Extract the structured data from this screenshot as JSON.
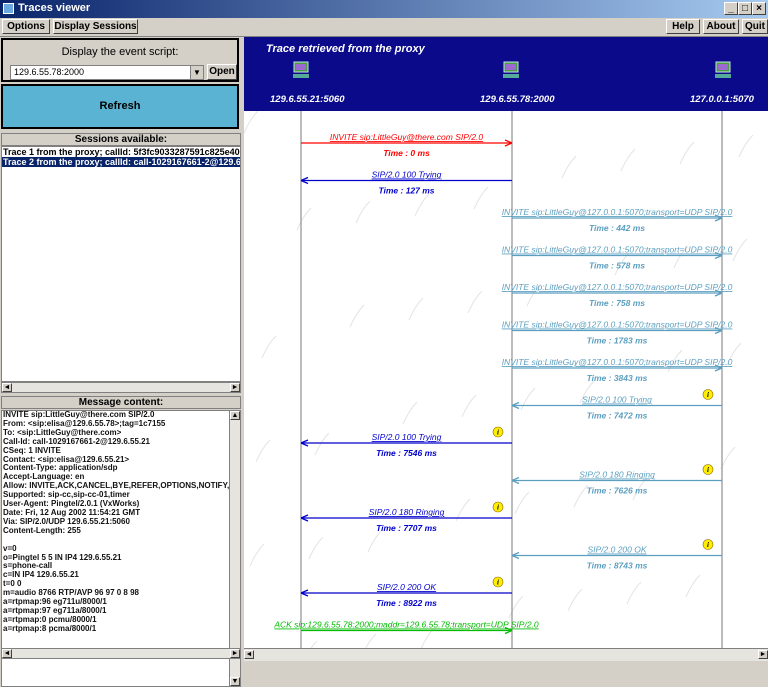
{
  "window": {
    "title": "Traces viewer",
    "controls": [
      "_",
      "□",
      "×"
    ]
  },
  "menubar": {
    "options": "Options",
    "display_sessions": "Display Sessions",
    "help": "Help",
    "about": "About",
    "quit": "Quit"
  },
  "script_panel": {
    "label": "Display the event script:",
    "selected": "129.6.55.78:2000",
    "open_label": "Open",
    "refresh_label": "Refresh"
  },
  "sessions": {
    "header": "Sessions available:",
    "items": [
      "Trace 1 from the proxy; callId: 5f3fc9033287591c825e40",
      "Trace 2 from the proxy; callId: call-1029167661-2@129.6"
    ],
    "selected_index": 1
  },
  "message": {
    "header": "Message content:",
    "lines": [
      "INVITE sip:LittleGuy@there.com SIP/2.0",
      "From: <sip:elisa@129.6.55.78>;tag=1c7155",
      "To: <sip:LittleGuy@there.com>",
      "Call-Id: call-1029167661-2@129.6.55.21",
      "CSeq: 1 INVITE",
      "Contact: <sip:elisa@129.6.55.21>",
      "Content-Type: application/sdp",
      "Accept-Language: en",
      "Allow: INVITE,ACK,CANCEL,BYE,REFER,OPTIONS,NOTIFY,REGISTE",
      "Supported: sip-cc,sip-cc-01,timer",
      "User-Agent: Pingtel/2.0.1 (VxWorks)",
      "Date: Fri, 12 Aug 2002 11:54:21 GMT",
      "Via: SIP/2.0/UDP 129.6.55.21:5060",
      "Content-Length: 255",
      "",
      "v=0",
      "o=Pingtel 5 5 IN IP4 129.6.55.21",
      "s=phone-call",
      "c=IN IP4 129.6.55.21",
      "t=0 0",
      "m=audio 8766 RTP/AVP 96 97 0 8 98",
      "a=rtpmap:96 eg711u/8000/1",
      "a=rtpmap:97 eg711a/8000/1",
      "a=rtpmap:0 pcmu/8000/1",
      "a=rtpmap:8 pcma/8000/1"
    ]
  },
  "trace": {
    "title": "Trace retrieved from the proxy",
    "nodes": [
      "129.6.55.21:5060",
      "129.6.55.78:2000",
      "127.0.0.1:5070"
    ],
    "colors": {
      "red": "#ff0000",
      "blue": "#0000cc",
      "teal": "#5b9fc0",
      "green": "#00bb00",
      "info": "#ffee00"
    },
    "messages": [
      {
        "from": 0,
        "to": 1,
        "label": "INVITE sip:LittleGuy@there.com SIP/2.0",
        "time": "Time : 0 ms",
        "color": "red",
        "info": false
      },
      {
        "from": 1,
        "to": 0,
        "label": "SIP/2.0 100 Trying",
        "time": "Time : 127 ms",
        "color": "blue",
        "info": false
      },
      {
        "from": 1,
        "to": 2,
        "label": "INVITE sip:LittleGuy@127.0.0.1:5070;transport=UDP SIP/2.0",
        "time": "Time : 442 ms",
        "color": "teal",
        "info": false
      },
      {
        "from": 1,
        "to": 2,
        "label": "INVITE sip:LittleGuy@127.0.0.1:5070;transport=UDP SIP/2.0",
        "time": "Time : 578 ms",
        "color": "teal",
        "info": false
      },
      {
        "from": 1,
        "to": 2,
        "label": "INVITE sip:LittleGuy@127.0.0.1:5070;transport=UDP SIP/2.0",
        "time": "Time : 758 ms",
        "color": "teal",
        "info": false
      },
      {
        "from": 1,
        "to": 2,
        "label": "INVITE sip:LittleGuy@127.0.0.1:5070;transport=UDP SIP/2.0",
        "time": "Time : 1783 ms",
        "color": "teal",
        "info": false
      },
      {
        "from": 1,
        "to": 2,
        "label": "INVITE sip:LittleGuy@127.0.0.1:5070;transport=UDP SIP/2.0",
        "time": "Time : 3843 ms",
        "color": "teal",
        "info": false
      },
      {
        "from": 2,
        "to": 1,
        "label": "SIP/2.0 100 Trying",
        "time": "Time : 7472 ms",
        "color": "teal",
        "info": true
      },
      {
        "from": 1,
        "to": 0,
        "label": "SIP/2.0 100 Trying",
        "time": "Time : 7546 ms",
        "color": "blue",
        "info": true
      },
      {
        "from": 2,
        "to": 1,
        "label": "SIP/2.0 180 Ringing",
        "time": "Time : 7626 ms",
        "color": "teal",
        "info": true
      },
      {
        "from": 1,
        "to": 0,
        "label": "SIP/2.0 180 Ringing",
        "time": "Time : 7707 ms",
        "color": "blue",
        "info": true
      },
      {
        "from": 2,
        "to": 1,
        "label": "SIP/2.0 200 OK",
        "time": "Time : 8743 ms",
        "color": "teal",
        "info": true
      },
      {
        "from": 1,
        "to": 0,
        "label": "SIP/2.0 200 OK",
        "time": "Time : 8922 ms",
        "color": "blue",
        "info": true
      },
      {
        "from": 0,
        "to": 1,
        "label": "ACK sip:129.6.55.78:2000;maddr=129.6.55.78;transport=UDP SIP/2.0",
        "time": "",
        "color": "green",
        "info": false
      }
    ]
  }
}
